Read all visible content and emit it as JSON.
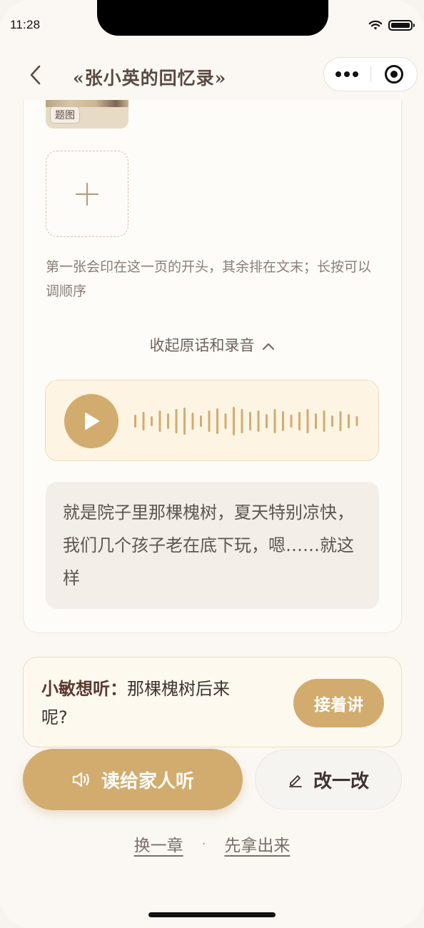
{
  "status_bar": {
    "time": "11:28"
  },
  "nav": {
    "title": "«张小英的回忆录»"
  },
  "photos": {
    "cover_badge": "题图",
    "hint": "第一张会印在这一页的开头，其余排在文末；长按可以调顺序"
  },
  "recording": {
    "collapse_label": "收起原话和录音",
    "transcript": "就是院子里那棵槐树，夏天特别凉快，我们几个孩子老在底下玩，嗯……就这样"
  },
  "suggestion": {
    "listener": "小敏想听：",
    "question": "那棵槐树后来呢?",
    "continue_label": "接着讲"
  },
  "actions": {
    "read_label": "读给家人听",
    "edit_label": "改一改"
  },
  "links": {
    "change_chapter": "换一章",
    "take_out": "先拿出来"
  },
  "colors": {
    "accent": "#D2AC6E",
    "title": "#5B4A44",
    "background": "#FBF8F3"
  }
}
